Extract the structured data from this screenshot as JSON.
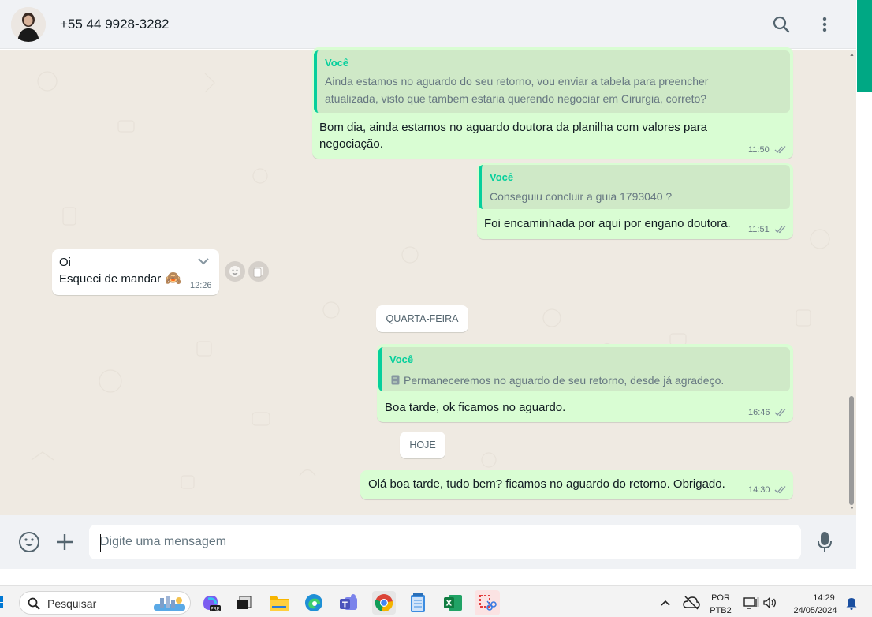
{
  "header": {
    "contact_name": "+55 44 9928-3282",
    "icons": [
      "avatar",
      "search-icon",
      "menu-icon"
    ]
  },
  "messages": [
    {
      "direction": "out",
      "quote_author": "Você",
      "quote_line1": "Ainda estamos no aguardo do seu retorno, vou enviar a tabela para preencher",
      "quote_line2": "atualizada, visto que tambem estaria querendo negociar em Cirurgia, correto?",
      "text_line1": "Bom dia, ainda estamos no aguardo doutora da planilha com valores para",
      "text_line2": "negociação.",
      "time": "11:50",
      "status": "read"
    },
    {
      "direction": "out",
      "quote_author": "Você",
      "quote_text": "Conseguiu concluir a guia 1793040  ?",
      "text": "Foi encaminhada por aqui por engano doutora.",
      "time": "11:51",
      "status": "read"
    },
    {
      "direction": "in",
      "text_line1": "Oi",
      "text_line2": "Esqueci de mandar",
      "emoji": "🙈",
      "time": "12:26"
    },
    {
      "direction": "out",
      "quote_author": "Você",
      "quote_text": "Permaneceremos no aguardo de seu retorno, desde já agradeço.",
      "text": "Boa tarde, ok ficamos no aguardo.",
      "time": "16:46",
      "status": "read"
    },
    {
      "direction": "out",
      "text": "Olá boa tarde, tudo bem? ficamos no aguardo do retorno. Obrigado.",
      "time": "14:30",
      "status": "read"
    }
  ],
  "day_separators": [
    "QUARTA-FEIRA",
    "HOJE"
  ],
  "composer": {
    "placeholder": "Digite uma mensagem",
    "icons": [
      "emoji-icon",
      "plus-icon",
      "microphone-icon"
    ]
  },
  "taskbar": {
    "search_label": "Pesquisar",
    "language_line1": "POR",
    "language_line2": "PTB2",
    "clock_time": "14:29",
    "clock_date": "24/05/2024",
    "apps": [
      "windows-start-icon",
      "copilot-icon",
      "task-view-icon",
      "file-explorer-icon",
      "edge-icon",
      "teams-icon",
      "chrome-icon",
      "notepad-icon",
      "excel-icon",
      "snipping-tool-icon"
    ]
  },
  "colors": {
    "chat_background": "#efeae2",
    "outgoing_bubble": "#d9fdd3",
    "incoming_bubble": "#ffffff",
    "quote_accent": "#06cf9c",
    "read_ticks": "#667781",
    "brand_green": "#00a884"
  }
}
